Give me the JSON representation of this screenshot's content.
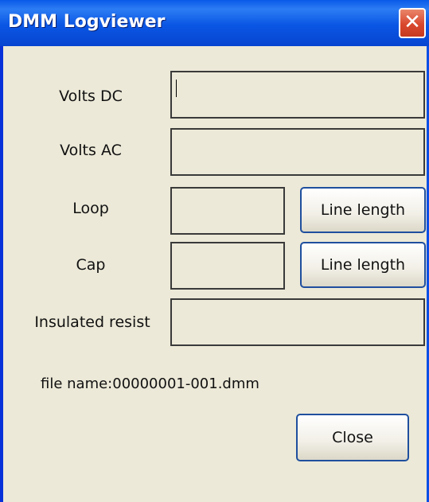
{
  "window": {
    "title": "DMM Logviewer",
    "close_glyph": "✕"
  },
  "fields": {
    "volts_dc": {
      "label": "Volts DC",
      "value": ""
    },
    "volts_ac": {
      "label": "Volts AC",
      "value": ""
    },
    "loop": {
      "label": "Loop",
      "value": "",
      "button": "Line length"
    },
    "cap": {
      "label": "Cap",
      "value": "",
      "button": "Line length"
    },
    "insulated": {
      "label": "Insulated resist",
      "value": ""
    }
  },
  "file": {
    "text": "file name:00000001-001.dmm"
  },
  "footer": {
    "close_label": "Close"
  }
}
